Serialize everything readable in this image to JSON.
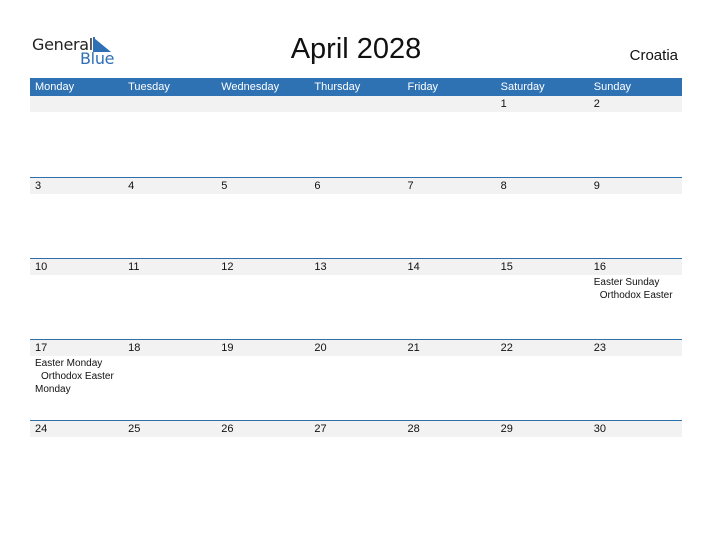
{
  "logo": {
    "general": "General",
    "blue": "Blue"
  },
  "title": "April 2028",
  "country": "Croatia",
  "colors": {
    "header": "#2f72b4",
    "strip": "#f2f2f2",
    "brand": "#2f6fb5"
  },
  "weekdays": [
    "Monday",
    "Tuesday",
    "Wednesday",
    "Thursday",
    "Friday",
    "Saturday",
    "Sunday"
  ],
  "weeks": [
    {
      "days": [
        "",
        "",
        "",
        "",
        "",
        "1",
        "2"
      ],
      "holidays": [
        [],
        [],
        [],
        [],
        [],
        [],
        []
      ]
    },
    {
      "days": [
        "3",
        "4",
        "5",
        "6",
        "7",
        "8",
        "9"
      ],
      "holidays": [
        [],
        [],
        [],
        [],
        [],
        [],
        []
      ]
    },
    {
      "days": [
        "10",
        "11",
        "12",
        "13",
        "14",
        "15",
        "16"
      ],
      "holidays": [
        [],
        [],
        [],
        [],
        [],
        [],
        [
          "Easter Sunday",
          " Orthodox Easter"
        ]
      ]
    },
    {
      "days": [
        "17",
        "18",
        "19",
        "20",
        "21",
        "22",
        "23"
      ],
      "holidays": [
        [
          "Easter Monday",
          " Orthodox Easter",
          "Monday"
        ],
        [],
        [],
        [],
        [],
        [],
        []
      ]
    },
    {
      "days": [
        "24",
        "25",
        "26",
        "27",
        "28",
        "29",
        "30"
      ],
      "holidays": [
        [],
        [],
        [],
        [],
        [],
        [],
        []
      ]
    }
  ]
}
